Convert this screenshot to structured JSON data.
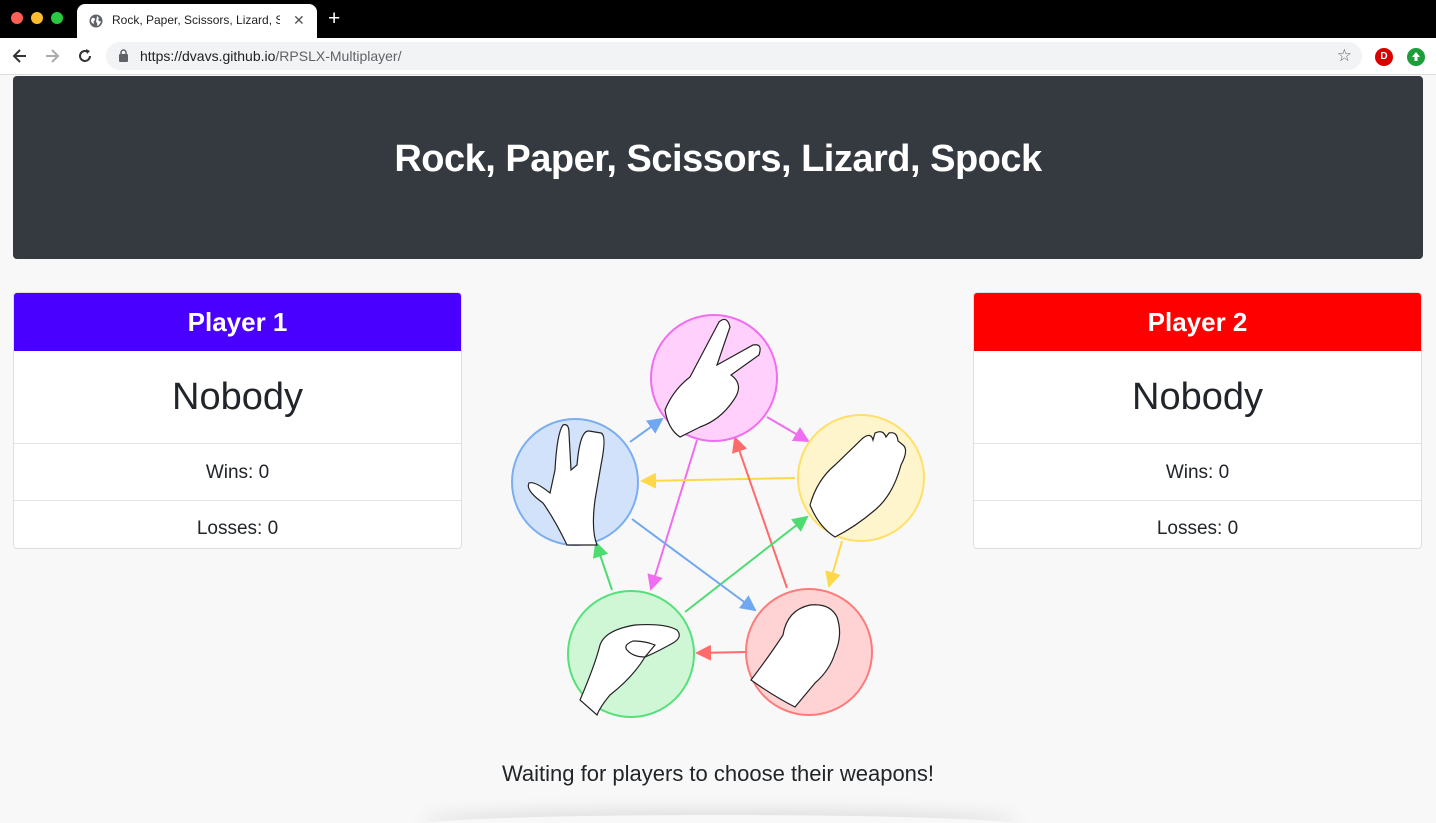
{
  "browser": {
    "tab_title": "Rock, Paper, Scissors, Lizard, S",
    "url_host": "https://dvavs.github.io",
    "url_path": "/RPSLX-Multiplayer/",
    "extension_1_label": "D"
  },
  "header": {
    "title": "Rock, Paper, Scissors, Lizard, Spock"
  },
  "players": [
    {
      "label": "Player 1",
      "name": "Nobody",
      "wins": "Wins: 0",
      "losses": "Losses: 0",
      "color": "#4a00ff"
    },
    {
      "label": "Player 2",
      "name": "Nobody",
      "wins": "Wins: 0",
      "losses": "Losses: 0",
      "color": "#ff0000"
    }
  ],
  "diagram": {
    "weapons": [
      {
        "name": "scissors",
        "fill": "#ffd0fb",
        "stroke": "#f06cf0"
      },
      {
        "name": "paper",
        "fill": "#fff5cc",
        "stroke": "#ffe066"
      },
      {
        "name": "rock",
        "fill": "#ffd3d3",
        "stroke": "#ff7a7a"
      },
      {
        "name": "lizard",
        "fill": "#cff7d6",
        "stroke": "#55e07a"
      },
      {
        "name": "spock",
        "fill": "#d3e2fb",
        "stroke": "#7aaef0"
      }
    ]
  },
  "status": "Waiting for players to choose their weapons!"
}
